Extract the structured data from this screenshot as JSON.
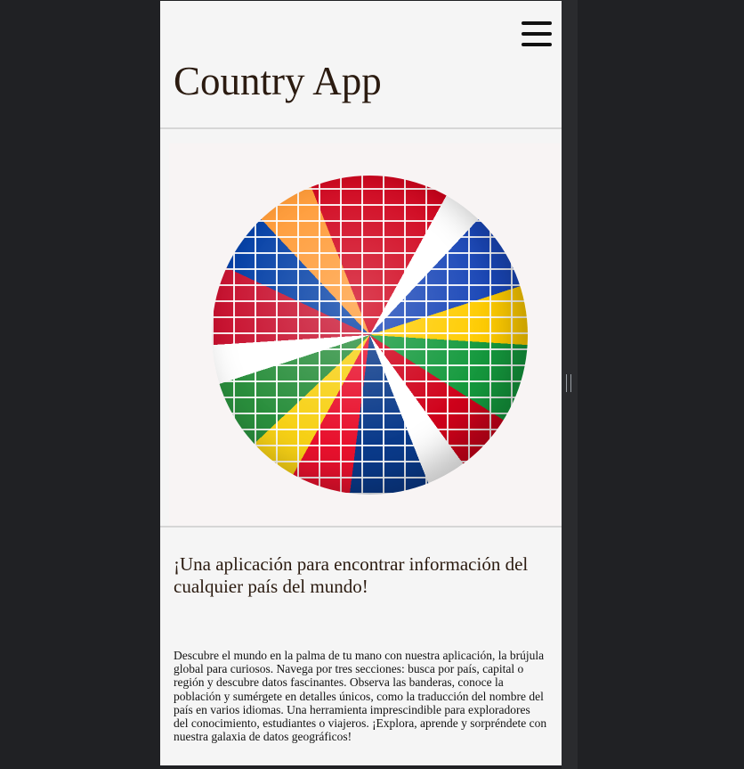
{
  "header": {
    "title": "Country App",
    "menu_icon": "hamburger-menu-icon"
  },
  "hero": {
    "image": "flag-globe-image"
  },
  "tagline": "¡Una aplicación para encontrar información del cualquier país del mundo!",
  "description": "Descubre el mundo en la palma de tu mano con nuestra aplicación, la brújula global para curiosos. Navega por tres secciones: busca por país, capital o región y descubre datos fascinantes. Observa las banderas, conoce la población y sumérgete en detalles únicos, como la traducción del nombre del país en varios idiomas. Una herramienta imprescindible para exploradores del conocimiento, estudiantes o viajeros. ¡Explora, aprende y sorpréndete con nuestra galaxia de datos geográficos!",
  "colors": {
    "page_background": "#f5f5f5",
    "outer_background": "#202124",
    "title_color": "#2b1b10"
  }
}
